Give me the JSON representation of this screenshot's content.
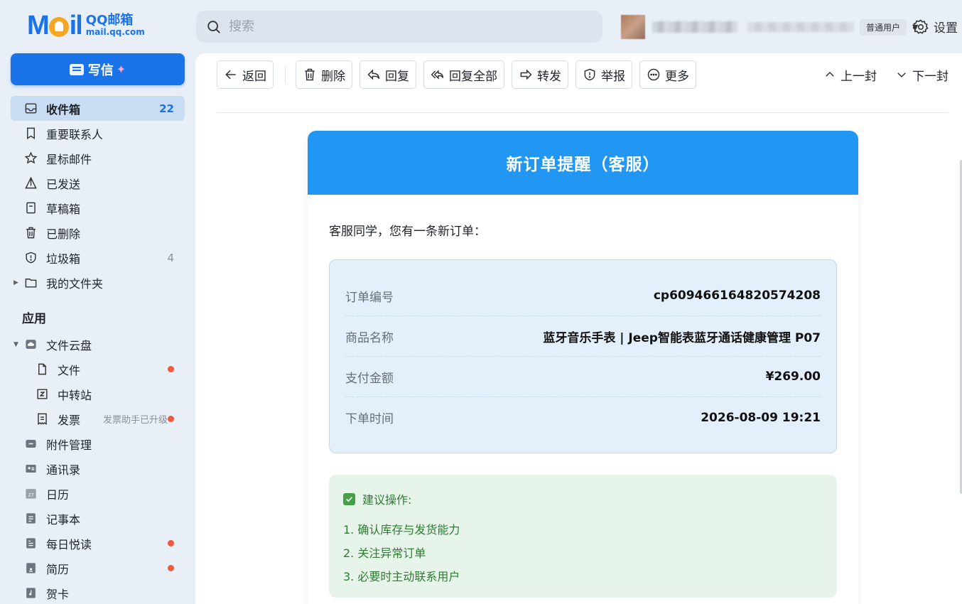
{
  "brand": {
    "cn": "QQ邮箱",
    "en": "mail.qq.com"
  },
  "search": {
    "placeholder": "搜索"
  },
  "user": {
    "badge": "普通用户"
  },
  "settings_label": "设置",
  "compose_label": "写信",
  "nav": {
    "inbox": {
      "label": "收件箱",
      "count": "22"
    },
    "vip": "重要联系人",
    "starred": "星标邮件",
    "sent": "已发送",
    "drafts": "草稿箱",
    "deleted": "已删除",
    "spam": {
      "label": "垃圾箱",
      "count": "4"
    },
    "folders": "我的文件夹"
  },
  "apps": {
    "title": "应用",
    "cloud": "文件云盘",
    "files": "文件",
    "transfer": "中转站",
    "invoice": {
      "label": "发票",
      "hint": "发票助手已升级"
    },
    "attachments": "附件管理",
    "contacts": "通讯录",
    "calendar": "日历",
    "notes": "记事本",
    "reading": "每日悦读",
    "resume": "简历",
    "cards": "贺卡"
  },
  "toolbar": {
    "back": "返回",
    "delete": "删除",
    "reply": "回复",
    "reply_all": "回复全部",
    "forward": "转发",
    "report": "举报",
    "more": "更多",
    "prev": "上一封",
    "next": "下一封"
  },
  "email": {
    "header": "新订单提醒（客服）",
    "greeting": "客服同学，您有一条新订单：",
    "rows": [
      {
        "key": "订单编号",
        "value": "cp609466164820574208"
      },
      {
        "key": "商品名称",
        "value": "蓝牙音乐手表 | Jeep智能表蓝牙通话健康管理 P07"
      },
      {
        "key": "支付金额",
        "value": "¥269.00"
      },
      {
        "key": "下单时间",
        "value": "2026-08-09 19:21"
      }
    ],
    "advice": {
      "title": "建议操作:",
      "items": [
        "1. 确认库存与发货能力",
        "2. 关注异常订单",
        "3. 必要时主动联系用户"
      ]
    }
  }
}
